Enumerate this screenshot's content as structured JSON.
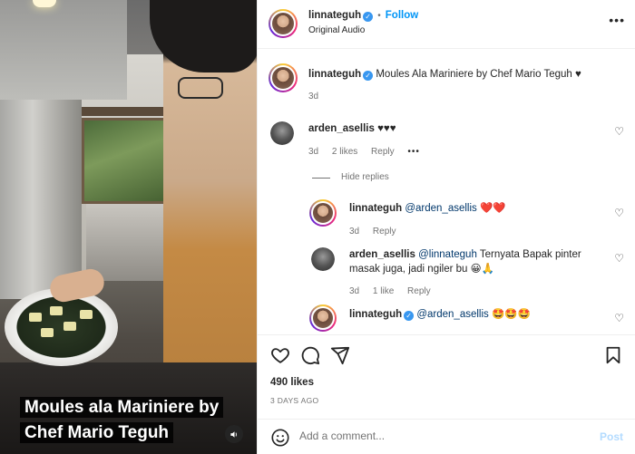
{
  "video": {
    "caption_line1": "Moules ala Mariniere by",
    "caption_line2": "Chef Mario Teguh",
    "sound_icon": "speaker-icon"
  },
  "header": {
    "username": "linnateguh",
    "follow_label": "Follow",
    "separator": "•",
    "audio_label": "Original Audio",
    "more_icon": "more-horizontal-icon"
  },
  "caption": {
    "username": "linnateguh",
    "text": "Moules Ala Mariniere by Chef Mario Teguh ♥",
    "time": "3d"
  },
  "comments": [
    {
      "username": "arden_asellis",
      "text": "♥♥♥",
      "time": "3d",
      "likes": "2 likes",
      "reply_label": "Reply",
      "options_label": "•••",
      "hide_replies_label": "Hide replies"
    }
  ],
  "replies": [
    {
      "username": "linnateguh",
      "mention": "@arden_asellis",
      "text": "❤️❤️",
      "time": "3d",
      "reply_label": "Reply"
    },
    {
      "username": "arden_asellis",
      "mention": "@linnateguh",
      "text_line1": "Ternyata Bapak pinter",
      "text_line2": "masak juga, jadi ngiler bu 😀🙏",
      "time": "3d",
      "likes": "1 like",
      "reply_label": "Reply"
    },
    {
      "username": "linnateguh",
      "mention": "@arden_asellis",
      "text": "🤩🤩🤩"
    }
  ],
  "actions": {
    "likes": "490 likes",
    "date": "3 DAYS AGO"
  },
  "add_comment": {
    "placeholder": "Add a comment...",
    "post_label": "Post"
  }
}
